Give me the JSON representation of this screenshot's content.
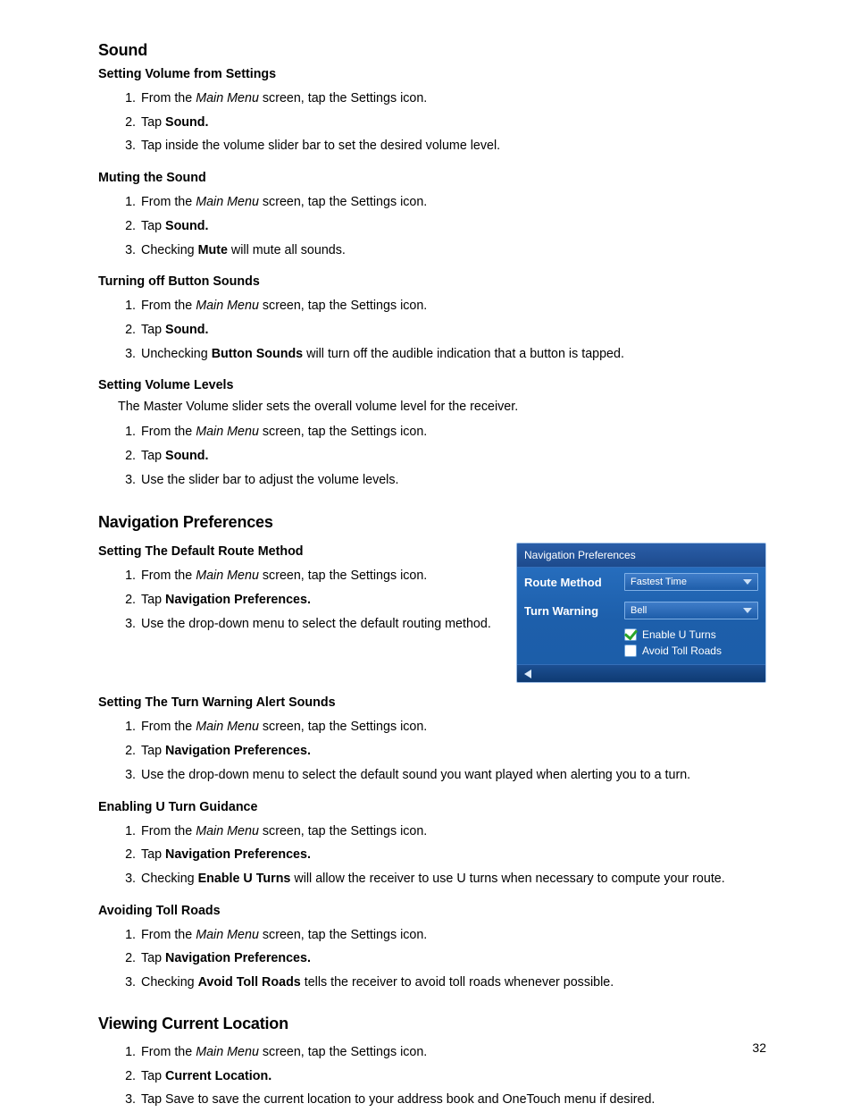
{
  "page_number": "32",
  "sections": {
    "sound": {
      "heading": "Sound",
      "groups": {
        "setting_volume": {
          "title": "Setting Volume from Settings",
          "steps": [
            {
              "before": "From the ",
              "italic": "Main Menu",
              "after": " screen, tap the Settings icon."
            },
            {
              "before": "Tap ",
              "bold": "Sound.",
              "after": ""
            },
            {
              "plain": "Tap inside the volume slider bar to set the desired volume level."
            }
          ]
        },
        "muting": {
          "title": "Muting the Sound",
          "steps": [
            {
              "before": "From the ",
              "italic": "Main Menu",
              "after": " screen, tap the Settings icon."
            },
            {
              "before": "Tap ",
              "bold": "Sound.",
              "after": ""
            },
            {
              "before": "Checking ",
              "bold": "Mute",
              "after": " will mute all sounds."
            }
          ]
        },
        "button_sounds": {
          "title": "Turning off Button Sounds",
          "steps": [
            {
              "before": "From the ",
              "italic": "Main Menu",
              "after": " screen, tap the Settings icon."
            },
            {
              "before": "Tap ",
              "bold": "Sound.",
              "after": ""
            },
            {
              "before": "Unchecking ",
              "bold": "Button Sounds",
              "after": " will turn off the audible indication that a button is tapped."
            }
          ]
        },
        "volume_levels": {
          "title": "Setting Volume Levels",
          "lead": "The Master Volume slider sets the overall volume level for the receiver.",
          "steps": [
            {
              "before": "From the ",
              "italic": "Main Menu",
              "after": " screen, tap the Settings icon."
            },
            {
              "before": "Tap ",
              "bold": "Sound.",
              "after": ""
            },
            {
              "plain": "Use the slider bar to adjust the volume levels."
            }
          ]
        }
      }
    },
    "nav": {
      "heading": "Navigation Preferences",
      "widget": {
        "title": "Navigation Preferences",
        "route_label": "Route Method",
        "route_value": "Fastest Time",
        "turn_label": "Turn Warning",
        "turn_value": "Bell",
        "check_uturns": "Enable U Turns",
        "check_tolls": "Avoid Toll Roads"
      },
      "groups": {
        "default_route": {
          "title": "Setting The Default Route Method",
          "steps": [
            {
              "before": "From the ",
              "italic": "Main Menu",
              "after": " screen, tap the Settings icon."
            },
            {
              "before": "Tap ",
              "bold": "Navigation Preferences.",
              "after": ""
            },
            {
              "plain": "Use the drop-down menu to select the default routing method."
            }
          ]
        },
        "turn_warning": {
          "title": "Setting The Turn Warning Alert Sounds",
          "steps": [
            {
              "before": "From the ",
              "italic": "Main Menu",
              "after": " screen, tap the Settings icon."
            },
            {
              "before": "Tap ",
              "bold": "Navigation Preferences.",
              "after": ""
            },
            {
              "plain": "Use the drop-down menu to select the default sound you want played when alerting you to a turn."
            }
          ]
        },
        "uturn": {
          "title": "Enabling U Turn Guidance",
          "steps": [
            {
              "before": "From the ",
              "italic": "Main Menu",
              "after": " screen, tap the Settings icon."
            },
            {
              "before": "Tap ",
              "bold": "Navigation Preferences.",
              "after": ""
            },
            {
              "before": "Checking ",
              "bold": "Enable U Turns",
              "after": " will allow the receiver to use U turns when necessary to compute your route."
            }
          ]
        },
        "tolls": {
          "title": "Avoiding Toll Roads",
          "steps": [
            {
              "before": "From the ",
              "italic": "Main Menu",
              "after": " screen, tap the Settings icon."
            },
            {
              "before": "Tap ",
              "bold": "Navigation Preferences.",
              "after": ""
            },
            {
              "before": "Checking ",
              "bold": "Avoid Toll Roads",
              "after": " tells the receiver to avoid toll roads whenever possible."
            }
          ]
        }
      }
    },
    "location": {
      "heading": "Viewing Current Location",
      "steps": [
        {
          "before": "From the ",
          "italic": "Main Menu",
          "after": " screen, tap the Settings icon."
        },
        {
          "before": "Tap ",
          "bold": "Current Location.",
          "after": ""
        },
        {
          "plain": "Tap Save to save the current location to your address book and OneTouch menu if desired."
        }
      ]
    }
  }
}
